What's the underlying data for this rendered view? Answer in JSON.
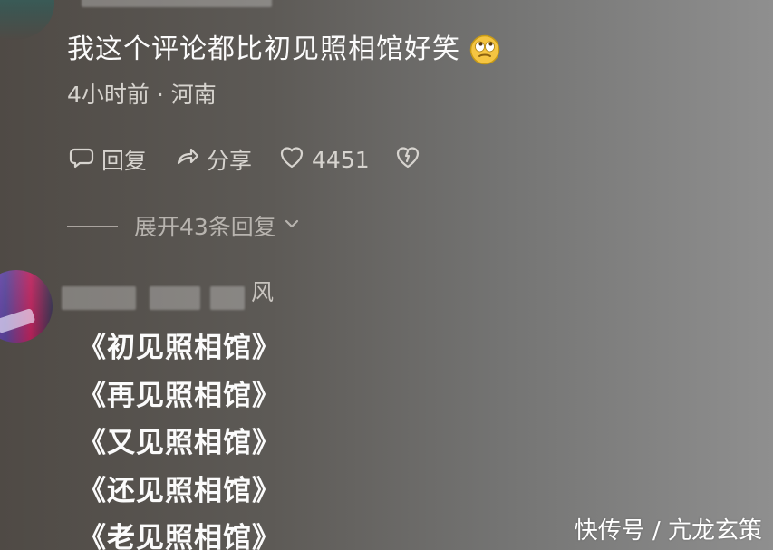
{
  "comment_1": {
    "text": "我这个评论都比初见照相馆好笑",
    "meta": "4小时前 · 河南",
    "actions": {
      "reply_label": "回复",
      "share_label": "分享",
      "like_count": "4451"
    },
    "expand_label": "展开43条回复"
  },
  "comment_2": {
    "username_visible_suffix": "风",
    "lines": [
      "《初见照相馆》",
      "《再见照相馆》",
      "《又见照相馆》",
      "《还见照相馆》",
      "《老见照相馆》"
    ]
  },
  "watermark": {
    "text": "快传号 / 亢龙玄策"
  }
}
